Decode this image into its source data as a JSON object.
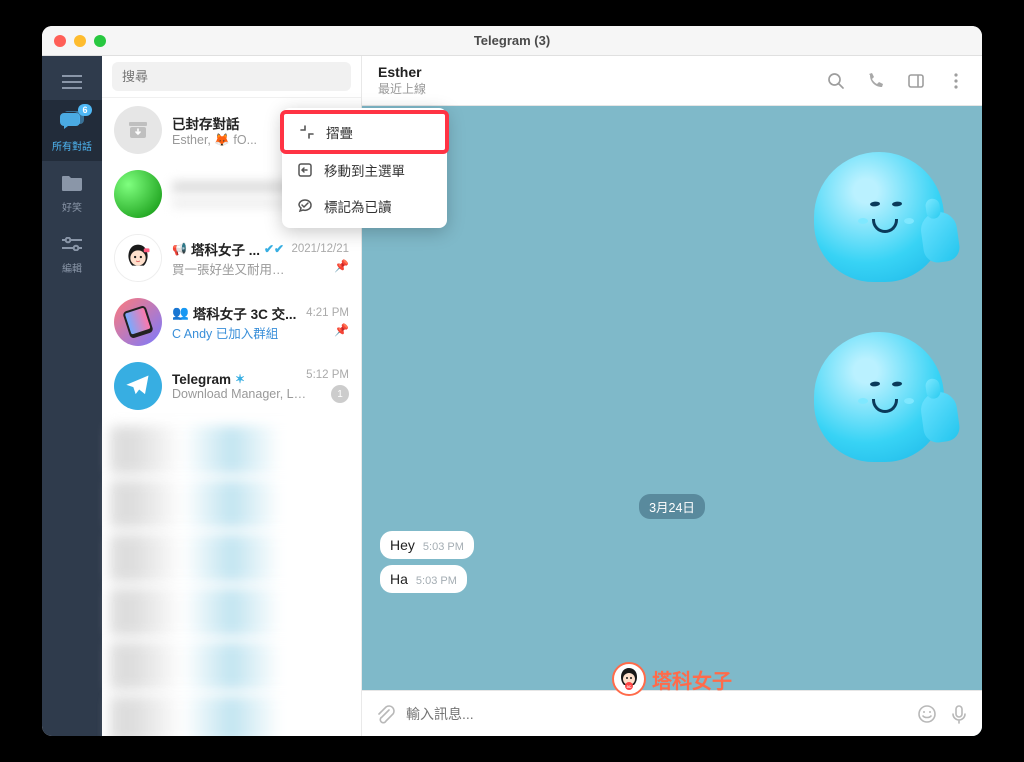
{
  "window_title": "Telegram (3)",
  "rail": {
    "badge": "6",
    "items": [
      {
        "label": "所有對話",
        "active": true
      },
      {
        "label": "好笑",
        "active": false
      },
      {
        "label": "編輯",
        "active": false
      }
    ]
  },
  "search": {
    "placeholder": "搜尋"
  },
  "chats": [
    {
      "name": "已封存對話",
      "preview": "Esther, 🦊 fO...",
      "type": "archive"
    },
    {
      "name": "",
      "preview": "",
      "time": "",
      "type": "blurred"
    },
    {
      "name": "塔科女子 ...",
      "preview": "買一張好坐又耐用的電腦...",
      "time": "2021/12/21",
      "verified": true,
      "announce": true,
      "pinned": true
    },
    {
      "name": "塔科女子 3C 交...",
      "preview": "C Andy 已加入群組",
      "time": "4:21 PM",
      "group": true,
      "pinned": true,
      "preview_link": true
    },
    {
      "name": "Telegram",
      "preview": "Download Manager, Liv...",
      "time": "5:12 PM",
      "verified": true,
      "unread": "1"
    }
  ],
  "context_menu": [
    {
      "label": "摺疊",
      "icon": "collapse",
      "highlight": true
    },
    {
      "label": "移動到主選單",
      "icon": "move"
    },
    {
      "label": "標記為已讀",
      "icon": "read"
    }
  ],
  "chat_header": {
    "name": "Esther",
    "status": "最近上線"
  },
  "date_label": "3月24日",
  "messages": [
    {
      "text": "Hey",
      "time": "5:03 PM"
    },
    {
      "text": "Ha",
      "time": "5:03 PM"
    }
  ],
  "input": {
    "placeholder": "輸入訊息..."
  },
  "watermark": "塔科女子"
}
